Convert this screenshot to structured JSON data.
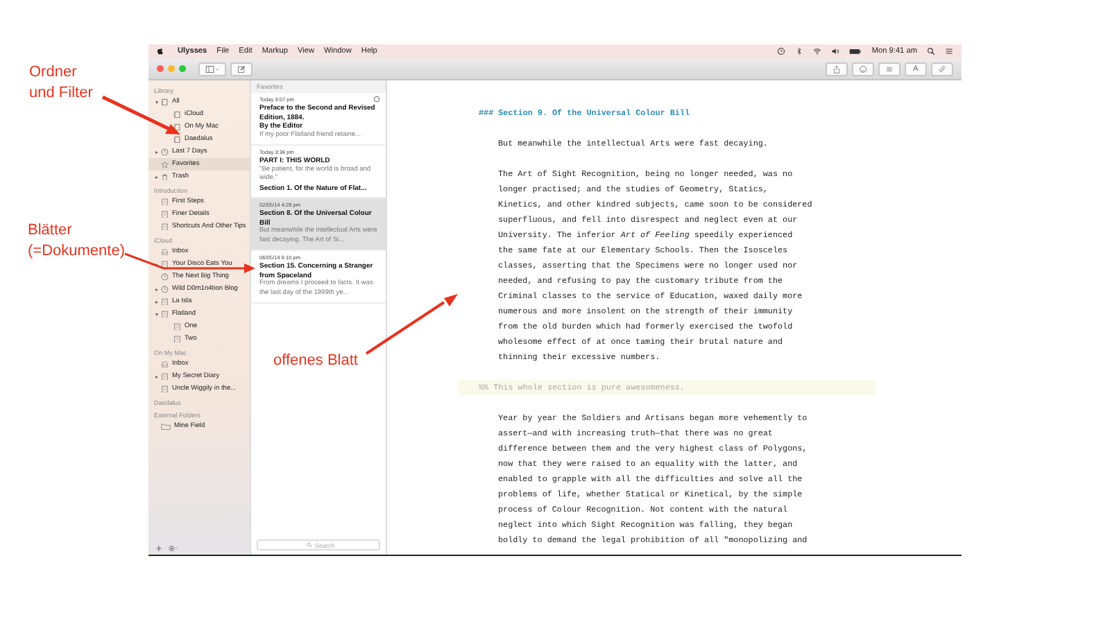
{
  "annotations": [
    {
      "kind": "folders",
      "lines": [
        "Ordner",
        "und Filter"
      ]
    },
    {
      "kind": "sheets",
      "lines": [
        "Blätter",
        "(=Dokumente)"
      ]
    },
    {
      "kind": "editor",
      "lines": [
        "offenes Blatt"
      ]
    }
  ],
  "menu_bar": {
    "app": "Ulysses",
    "items": [
      "File",
      "Edit",
      "Markup",
      "View",
      "Window",
      "Help"
    ],
    "clock": "Mon 9:41 am"
  },
  "toolbar": {
    "font_button": "A"
  },
  "sidebar": {
    "sections": [
      {
        "title": "Library",
        "items": [
          {
            "label": "All",
            "kind": "group",
            "expanded": true,
            "selected": false,
            "children": [
              {
                "label": "iCloud",
                "kind": "group",
                "selected": false
              },
              {
                "label": "On My Mac",
                "kind": "group",
                "selected": false
              },
              {
                "label": "Daedalus",
                "kind": "group",
                "selected": false
              }
            ]
          },
          {
            "label": "Last 7 Days",
            "kind": "filter",
            "expanded": false,
            "selected": false
          },
          {
            "label": "Favorites",
            "kind": "star",
            "selected": true
          },
          {
            "label": "Trash",
            "kind": "trash",
            "expanded": false,
            "selected": false
          }
        ]
      },
      {
        "title": "Introduction",
        "items": [
          {
            "label": "First Steps",
            "kind": "sheet",
            "selected": false
          },
          {
            "label": "Finer Details",
            "kind": "sheet",
            "selected": false
          },
          {
            "label": "Shortcuts And Other Tips",
            "kind": "sheet",
            "selected": false
          }
        ]
      },
      {
        "title": "iCloud",
        "items": [
          {
            "label": "Inbox",
            "kind": "inbox",
            "selected": false
          },
          {
            "label": "Your Disco Eats You",
            "kind": "sheet",
            "expanded": false,
            "selected": false
          },
          {
            "label": "The Next Big Thing",
            "kind": "filter",
            "selected": false
          },
          {
            "label": "Wild D0m1n4tion Blog",
            "kind": "filter",
            "expanded": false,
            "selected": false
          },
          {
            "label": "La Isla",
            "kind": "sheet",
            "expanded": false,
            "selected": false
          },
          {
            "label": "Flatland",
            "kind": "sheet",
            "expanded": true,
            "selected": false,
            "children": [
              {
                "label": "One",
                "kind": "sheet",
                "selected": false
              },
              {
                "label": "Two",
                "kind": "sheet",
                "selected": false
              }
            ]
          }
        ]
      },
      {
        "title": "On My Mac",
        "items": [
          {
            "label": "Inbox",
            "kind": "inbox",
            "selected": false
          },
          {
            "label": "My Secret Diary",
            "kind": "sheet",
            "expanded": false,
            "selected": false
          },
          {
            "label": "Uncle Wiggily in the...",
            "kind": "sheet",
            "selected": false
          }
        ]
      },
      {
        "title": "Daedalus"
      },
      {
        "title": "External Folders",
        "items": [
          {
            "label": "Mine Field",
            "kind": "folder",
            "selected": false
          }
        ]
      }
    ]
  },
  "sheet_list": {
    "title": "Favorites",
    "search": {
      "placeholder": "Search"
    },
    "sheets": [
      {
        "date": "Today 3:07 pm",
        "selected": false,
        "lines": [
          {
            "kind": "heading",
            "text": "Preface to the Second and Revised Edition, 1884."
          },
          {
            "kind": "heading",
            "text": "By the Editor"
          },
          {
            "kind": "preview",
            "text": "If my poor Flatland friend retaine..."
          }
        ]
      },
      {
        "date": "Today 3:36 pm",
        "selected": false,
        "lines": [
          {
            "kind": "heading",
            "text": "PART I: THIS WORLD"
          },
          {
            "kind": "preview",
            "text": "\"Be patient, for the world is broad and wide.\""
          },
          {
            "kind": "heading",
            "text": "Section 1. Of the Nature of Flat..."
          }
        ]
      },
      {
        "date": "02/05/14 4:28 pm",
        "selected": true,
        "lines": [
          {
            "kind": "heading",
            "text": "Section 8. Of the Universal Colour Bill"
          },
          {
            "kind": "preview",
            "text": "But meanwhile the intellectual Arts were fast decaying. The Art of Si..."
          }
        ]
      },
      {
        "date": "06/05/14 6:10 pm",
        "selected": false,
        "lines": [
          {
            "kind": "heading",
            "text": "Section 15. Concerning a Stranger from Spaceland"
          },
          {
            "kind": "preview",
            "text": "From dreams I proceed to facts. It was the last day of the 1999th ye..."
          }
        ]
      }
    ]
  },
  "editor": {
    "blocks": [
      {
        "kind": "heading",
        "lines": [
          "### Section 9. Of the Universal Colour Bill"
        ]
      },
      {
        "kind": "paragraph",
        "lines": [
          "But meanwhile the intellectual Arts were fast decaying."
        ]
      },
      {
        "kind": "paragraph",
        "lines": [
          "The Art of Sight Recognition, being no longer needed, was no",
          "longer practised; and the studies of Geometry, Statics,",
          "Kinetics, and other kindred subjects, came soon to be considered",
          "superfluous, and fell into disrespect and neglect even at our",
          "University. The inferior *Art of Feeling* speedily experienced",
          "the same fate at our Elementary Schools. Then the Isosceles",
          "classes, asserting that the Specimens were no longer used nor",
          "needed, and refusing to pay the customary tribute from the",
          "Criminal classes to the service of Education, waxed daily more",
          "numerous and more insolent on the strength of their immunity",
          "from the old burden which had formerly exercised the twofold",
          "wholesome effect of at once taming their brutal nature and",
          "thinning their excessive numbers."
        ]
      },
      {
        "kind": "comment",
        "lines": [
          "%% This whole section is pure awesomeness."
        ]
      },
      {
        "kind": "paragraph",
        "lines": [
          "Year by year the Soldiers and Artisans began more vehemently to",
          "assert—and with increasing truth—that there was no great",
          "difference between them and the very highest class of Polygons,",
          "now that they were raised to an equality with the latter, and",
          "enabled to grapple with all the difficulties and solve all the",
          "problems of life, whether Statical or Kinetical, by the simple",
          "process of Colour Recognition. Not content with the natural",
          "neglect into which Sight Recognition was falling, they began",
          "boldly to demand the legal prohibition of all \"monopolizing and"
        ]
      }
    ]
  }
}
